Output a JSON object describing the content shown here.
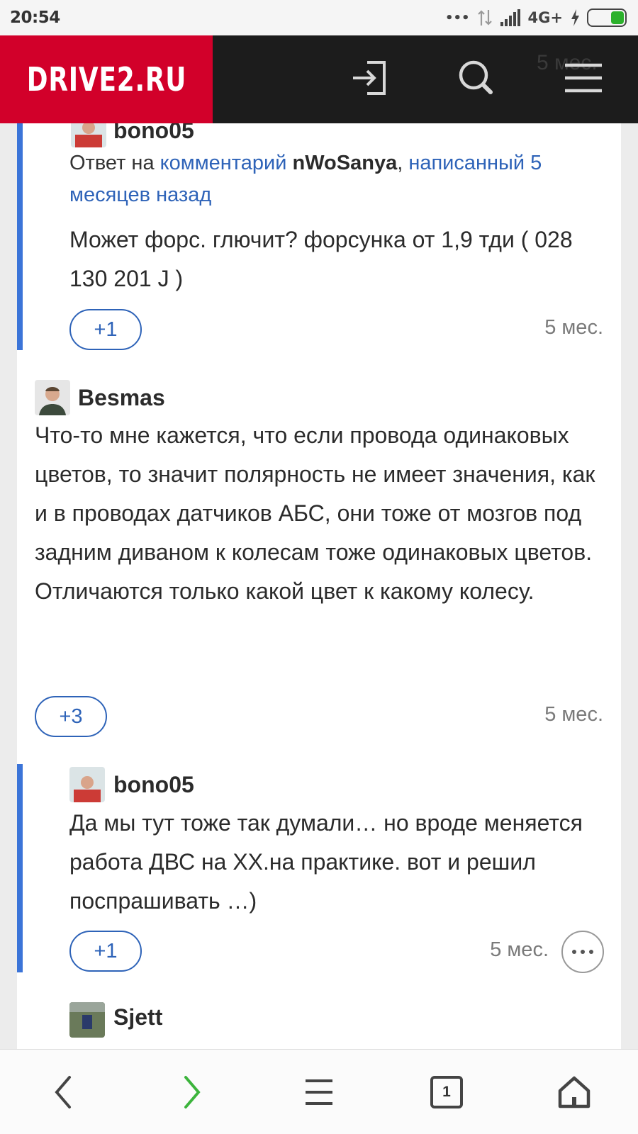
{
  "status": {
    "time": "20:54",
    "dots": "•••",
    "network": "4G+",
    "battery_color": "#2bb12b"
  },
  "header": {
    "logo": "DRIVE2.RU",
    "ghost_time": "5 мес.",
    "icons": [
      "login-icon",
      "search-icon",
      "menu-icon"
    ]
  },
  "comments": [
    {
      "author": "bono05",
      "reply_prefix": "Ответ на ",
      "reply_link": "комментарий",
      "reply_user": "nWoSanya",
      "reply_suffix": ", ",
      "reply_written": "написанный 5 месяцев назад",
      "text": "Может форс. глючит? форсунка от 1,9 тди ( 028 130 201 J )",
      "votes": "+1",
      "time": "5 мес."
    },
    {
      "author": "Besmas",
      "text": "Что-то мне кажется, что если провода одинаковых цветов, то значит полярность не имеет значения, как и в проводах датчиков АБС, они тоже от мозгов под задним диваном к колесам тоже одинаковых цветов. Отличаются только какой цвет к какому колесу.",
      "votes": "+3",
      "time": "5 мес."
    },
    {
      "author": "bono05",
      "text": "Да мы тут тоже так думали… но вроде меняется работа ДВС на ХХ.на практике. вот и решил поспрашивать …)",
      "votes": "+1",
      "time": "5 мес."
    },
    {
      "author": "Sjett"
    }
  ],
  "bottom_nav": {
    "tab_count": "1",
    "forward_color": "#3cb43c"
  },
  "colors": {
    "brand": "#d2002a",
    "link": "#2e63b8",
    "reply_bar": "#3b74d8"
  }
}
